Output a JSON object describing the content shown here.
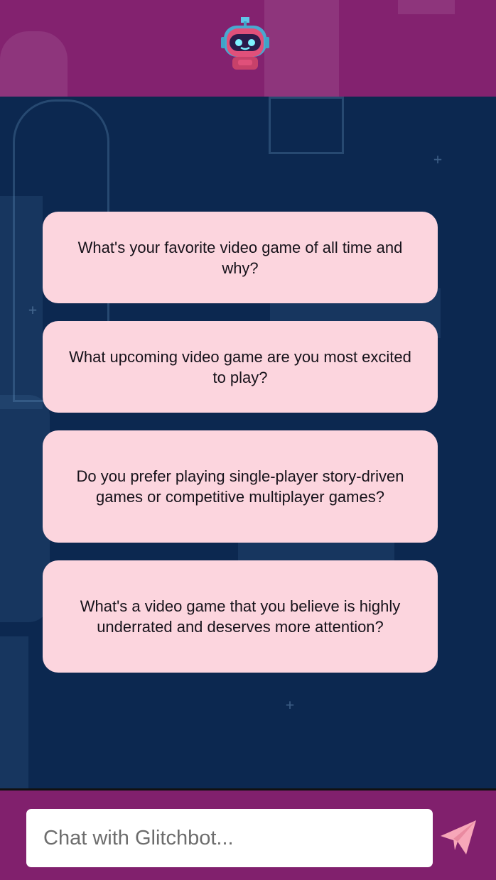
{
  "header": {
    "avatar_icon": "glitchbot-robot-icon",
    "accent": "#83226f"
  },
  "suggestions": [
    {
      "text": "What's your favorite video game of all time and why?"
    },
    {
      "text": "What upcoming video game are you most excited to play?"
    },
    {
      "text": "Do you prefer playing single-player story-driven games or competitive multiplayer games?"
    },
    {
      "text": "What's a video game that you believe is highly underrated and deserves more attention?"
    }
  ],
  "chat": {
    "placeholder": "Chat with Glitchbot...",
    "value": "",
    "send_icon": "send-plane-icon"
  },
  "colors": {
    "card_bg": "#fcd5de",
    "background": "#0c2850",
    "send_icon": "#f7a7b9"
  }
}
